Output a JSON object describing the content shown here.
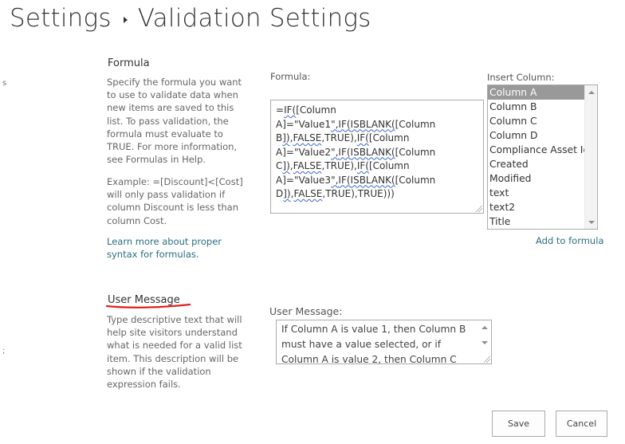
{
  "page": {
    "breadcrumb_root": "Settings",
    "breadcrumb_current": "Validation Settings",
    "edge_marks": [
      "s",
      ";"
    ]
  },
  "formula_section": {
    "heading": "Formula",
    "description": "Specify the formula you want to use to validate data when new items are saved to this list. To pass validation, the formula must evaluate to TRUE. For more information, see Formulas in Help.",
    "example": "Example: =[Discount]<[Cost] will only pass validation if column Discount is less than column Cost.",
    "learn_more_link": "Learn more about proper syntax for formulas.",
    "field_label": "Formula:",
    "formula_value": "=IF([Column A]=\"Value1\",IF(ISBLANK([Column B]),FALSE,TRUE),IF([Column A]=\"Value2\",IF(ISBLANK([Column C]),FALSE,TRUE),IF([Column A]=\"Value3\",IF(ISBLANK([Column D]),FALSE,TRUE),TRUE)))"
  },
  "insert_column": {
    "label": "Insert Column:",
    "items": [
      "Column A",
      "Column B",
      "Column C",
      "Column D",
      "Compliance Asset Id",
      "Created",
      "Modified",
      "text",
      "text2",
      "Title"
    ],
    "selected": "Column A",
    "add_link": "Add to formula"
  },
  "user_message_section": {
    "heading": "User Message",
    "description": "Type descriptive text that will help site visitors understand what is needed for a valid list item. This description will be shown if the validation expression fails.",
    "field_label": "User Message:",
    "value": "If Column A is value 1, then Column B must have a value selected, or if Column A is value 2, then Column C must have a"
  },
  "buttons": {
    "save": "Save",
    "cancel": "Cancel"
  },
  "colors": {
    "link": "#2a6e80",
    "selected_item_bg": "#999999",
    "annotation_red": "#e0201c",
    "spellcheck_blue": "#3a67c8"
  }
}
